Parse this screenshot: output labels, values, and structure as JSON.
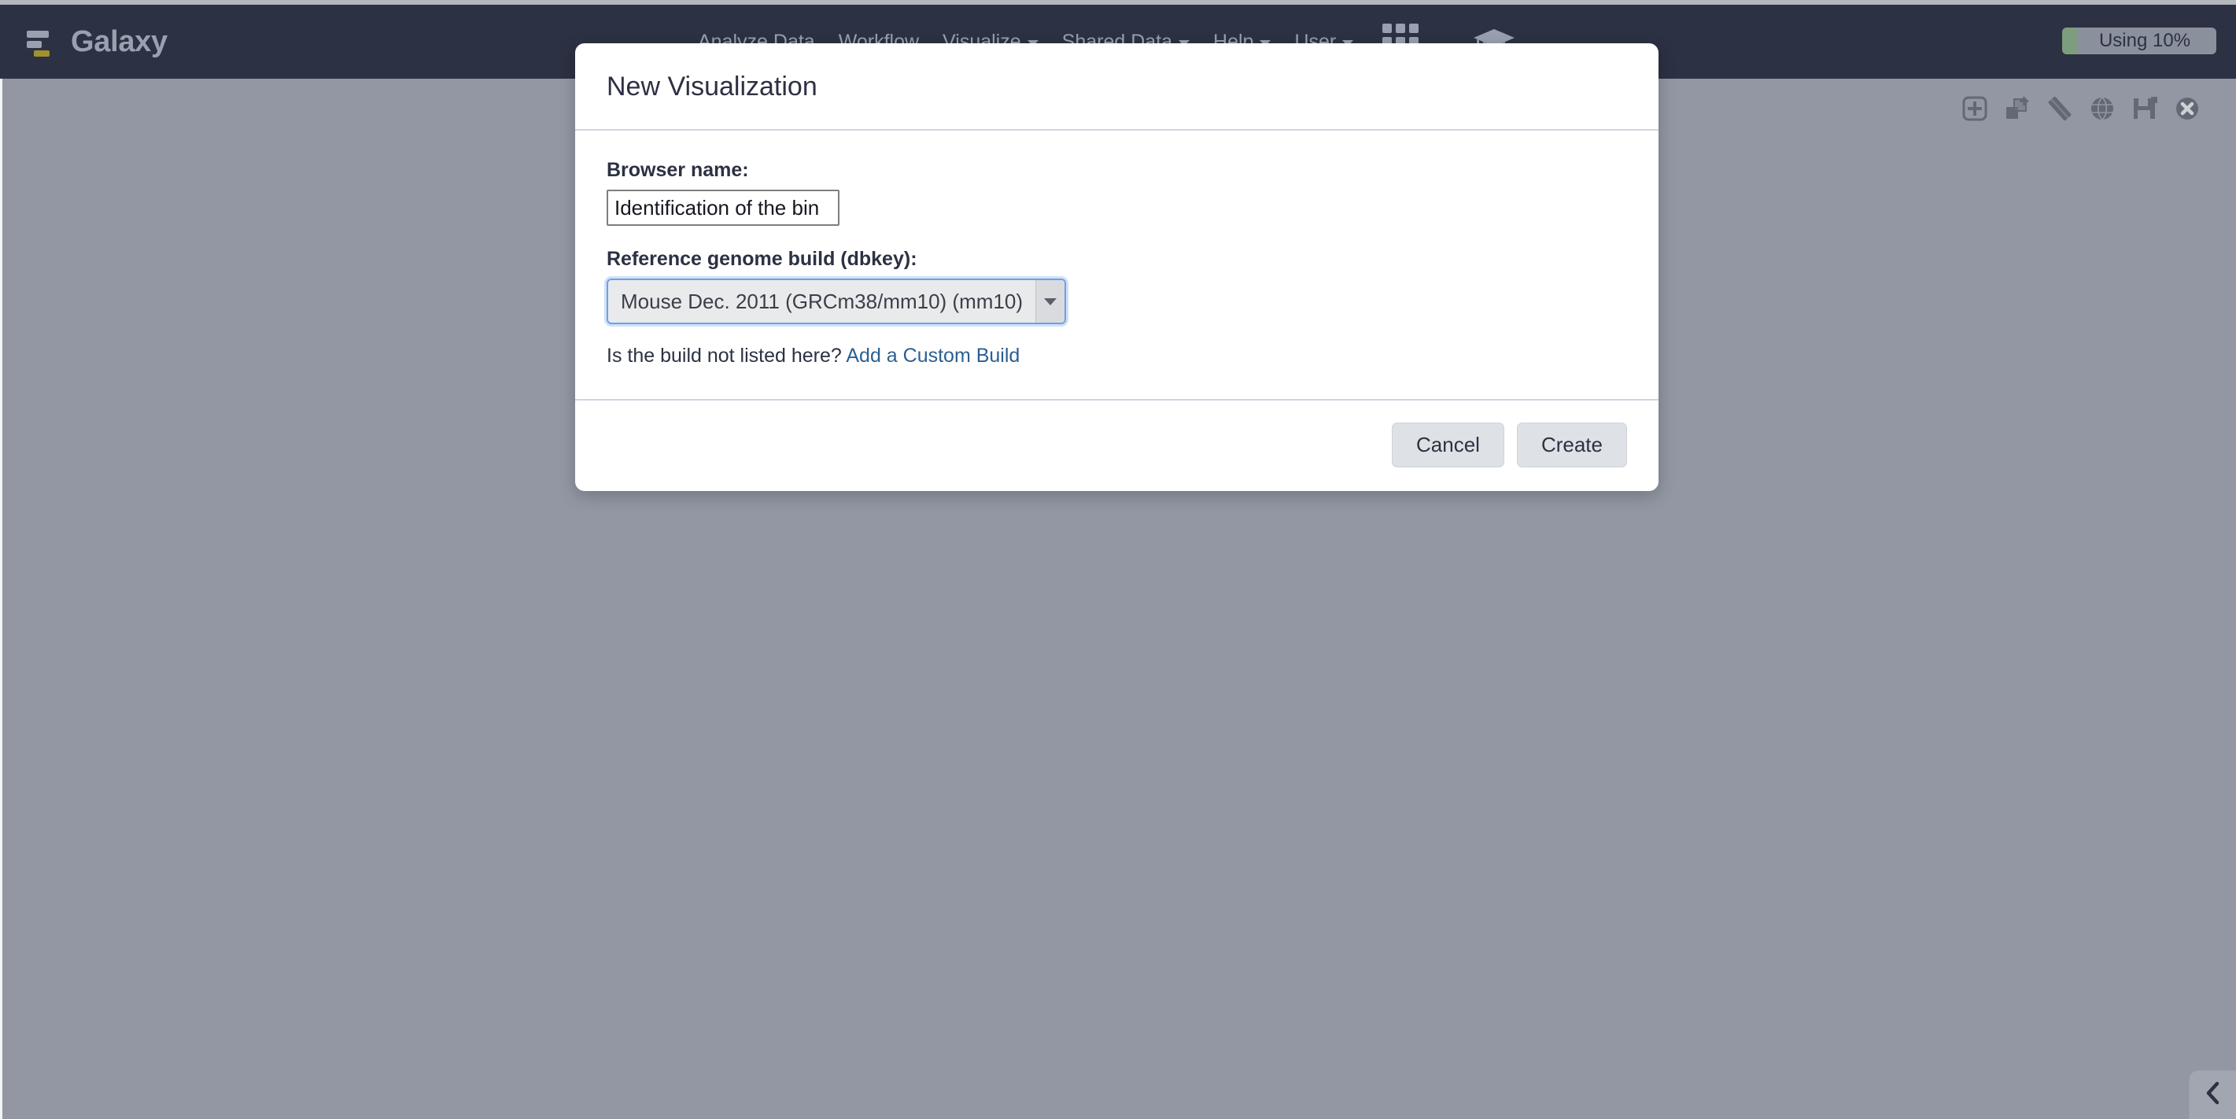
{
  "masthead": {
    "brand": "Galaxy",
    "brand_logo_icon": "galaxy-bars-logo",
    "nav": [
      {
        "label": "Analyze Data",
        "has_caret": false
      },
      {
        "label": "Workflow",
        "has_caret": false
      },
      {
        "label": "Visualize",
        "has_caret": true
      },
      {
        "label": "Shared Data",
        "has_caret": true
      },
      {
        "label": "Help",
        "has_caret": true
      },
      {
        "label": "User",
        "has_caret": true
      }
    ],
    "grid_icon": "apps-grid-icon",
    "training_icon": "graduation-cap-icon",
    "usage": {
      "label": "Using 10%",
      "percent": 10,
      "fill_color": "#7d9e7e",
      "track_color": "#8b909d"
    }
  },
  "viz_toolbar": {
    "icons": [
      {
        "name": "add-tracks-icon",
        "title": "Add tracks"
      },
      {
        "name": "add-group-icon",
        "title": "Add group"
      },
      {
        "name": "bookmarks-icon",
        "title": "Bookmarks"
      },
      {
        "name": "globe-icon",
        "title": "Circster"
      },
      {
        "name": "save-icon",
        "title": "Save"
      },
      {
        "name": "close-icon",
        "title": "Close"
      }
    ]
  },
  "bottom_panel": {
    "toggle_icon": "chevron-left-icon"
  },
  "modal": {
    "title": "New Visualization",
    "browser_name": {
      "label": "Browser name:",
      "value": "Identification of the bin",
      "placeholder": ""
    },
    "dbkey": {
      "label": "Reference genome build (dbkey):",
      "selected": "Mouse Dec. 2011 (GRCm38/mm10) (mm10)",
      "arrow_icon": "chevron-down-icon"
    },
    "helper": {
      "text": "Is the build not listed here? ",
      "link": "Add a Custom Build"
    },
    "footer": {
      "cancel_label": "Cancel",
      "create_label": "Create"
    }
  },
  "colors": {
    "masthead_bg": "#2c3143",
    "page_bg": "#9297a3",
    "link": "#2b5f92",
    "focus_border": "#6da0e8"
  }
}
